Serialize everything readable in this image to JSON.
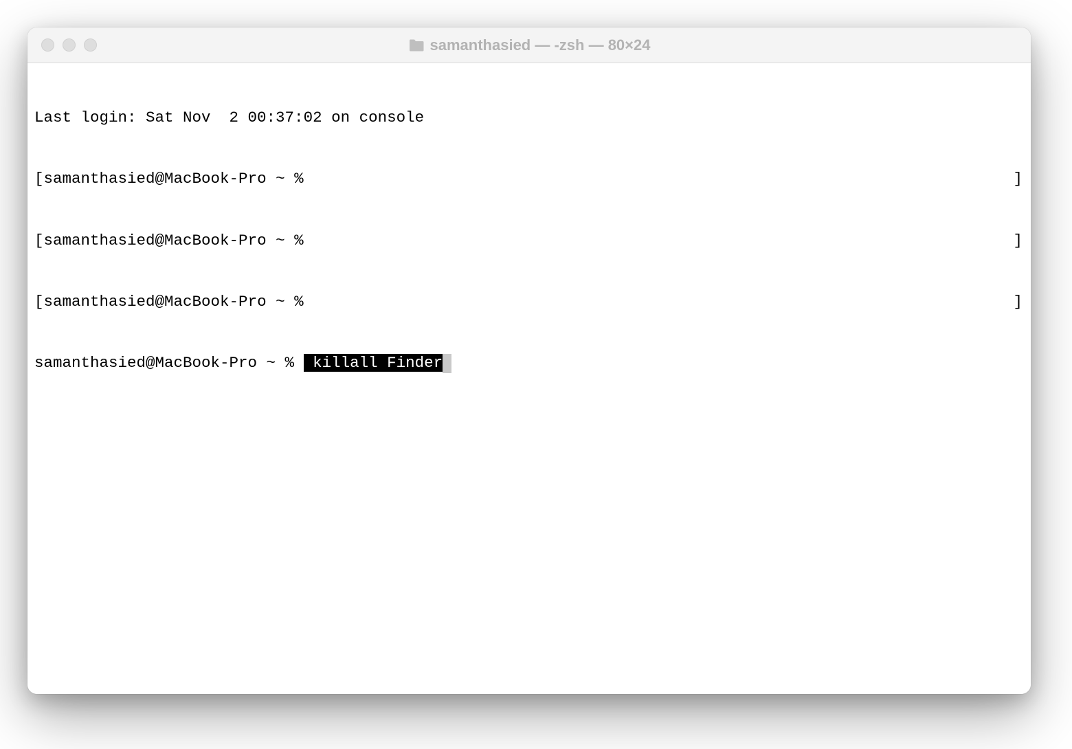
{
  "window": {
    "title": "samanthasied — -zsh — 80×24"
  },
  "terminal": {
    "last_login": "Last login: Sat Nov  2 00:37:02 on console",
    "prompt": "samanthasied@MacBook-Pro ~ % ",
    "empty_lines": [
      "samanthasied@MacBook-Pro ~ % ",
      "samanthasied@MacBook-Pro ~ % ",
      "samanthasied@MacBook-Pro ~ % "
    ],
    "current_command": " killall Finder",
    "right_bracket": "]"
  }
}
